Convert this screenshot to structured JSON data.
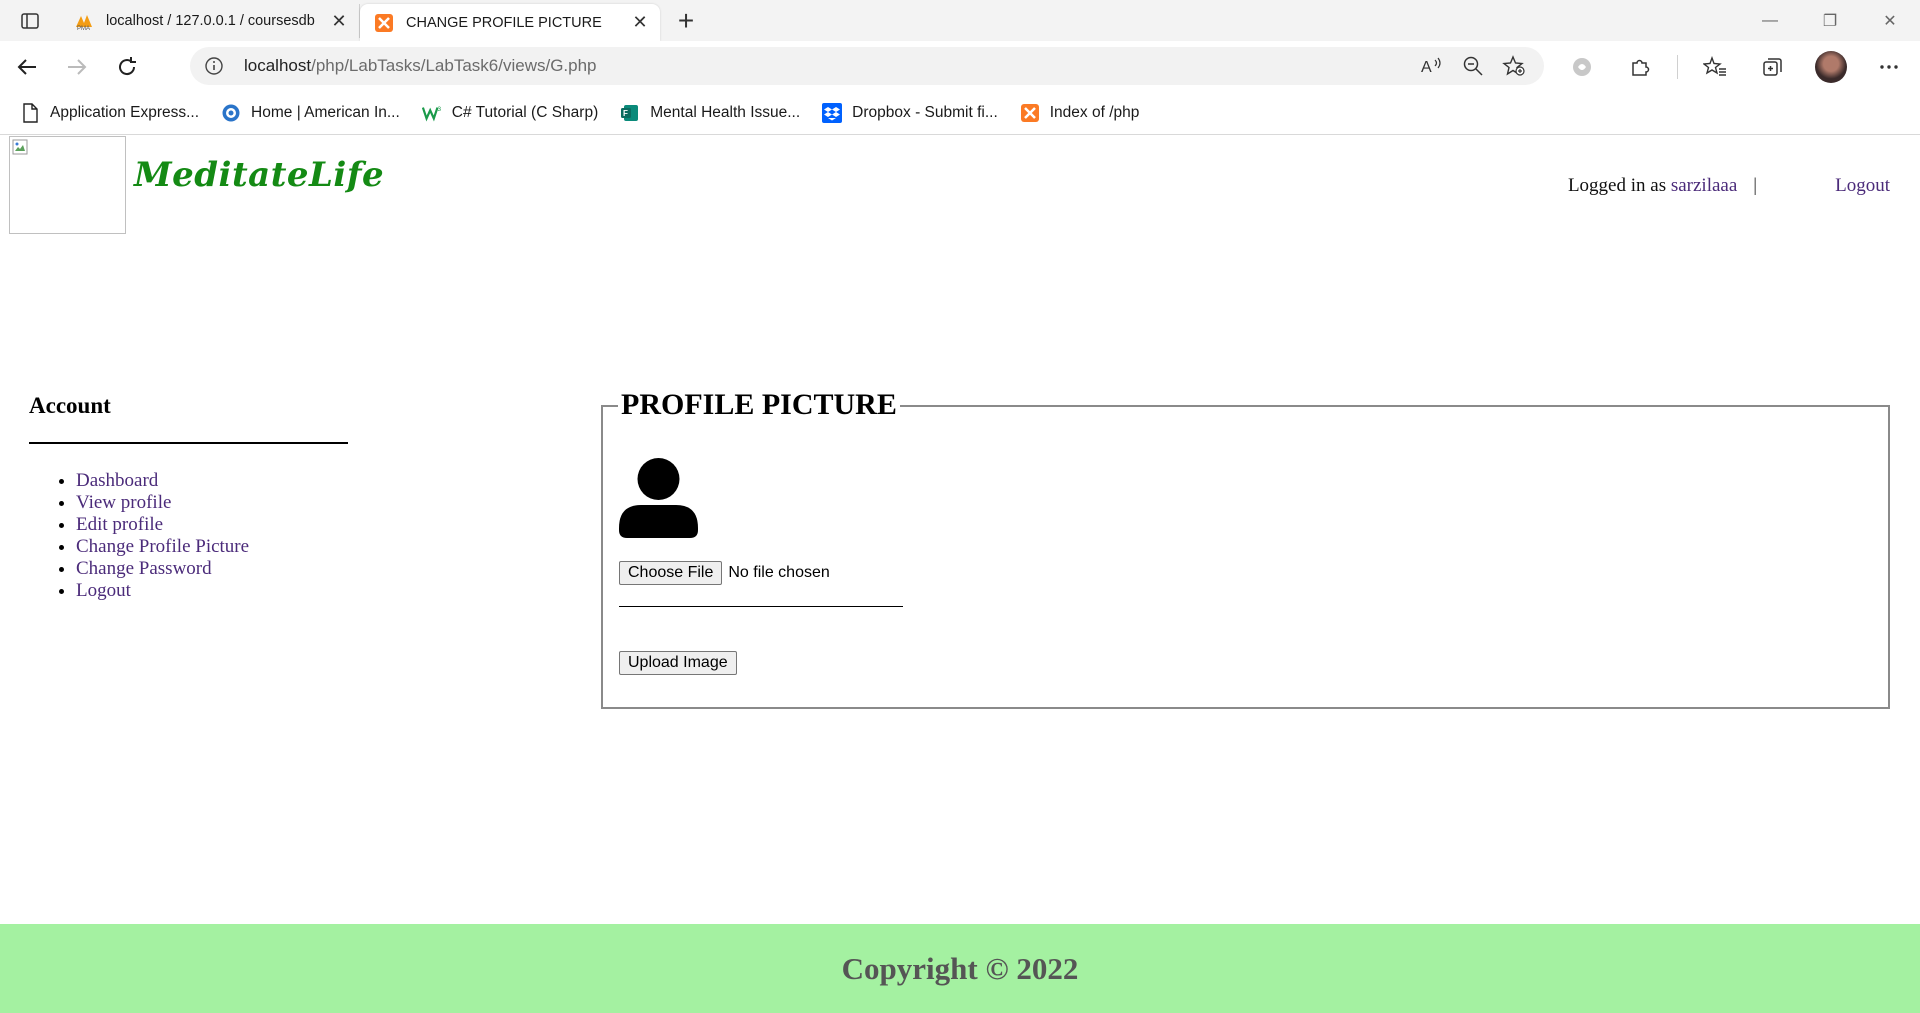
{
  "browser": {
    "tabs": [
      {
        "title": "localhost / 127.0.0.1 / coursesdb",
        "active": false
      },
      {
        "title": "CHANGE PROFILE PICTURE",
        "active": true
      }
    ],
    "url_host": "localhost",
    "url_path": "/php/LabTasks/LabTask6/views/G.php",
    "bookmarks": [
      {
        "label": "Application Express...",
        "icon": "page-icon"
      },
      {
        "label": "Home | American In...",
        "icon": "globe-icon"
      },
      {
        "label": "C# Tutorial (C Sharp)",
        "icon": "w3-icon"
      },
      {
        "label": "Mental Health Issue...",
        "icon": "forms-icon"
      },
      {
        "label": "Dropbox - Submit fi...",
        "icon": "dropbox-icon"
      },
      {
        "label": "Index of /php",
        "icon": "xampp-icon"
      }
    ]
  },
  "header": {
    "brand": "MeditateLife",
    "logged_in_prefix": "Logged in as",
    "username": "sarzilaaa",
    "separator": "|",
    "logout": "Logout"
  },
  "sidebar": {
    "title": "Account",
    "items": [
      {
        "label": "Dashboard"
      },
      {
        "label": "View profile"
      },
      {
        "label": "Edit profile"
      },
      {
        "label": "Change Profile Picture"
      },
      {
        "label": "Change Password"
      },
      {
        "label": "Logout"
      }
    ]
  },
  "main": {
    "legend": "PROFILE PICTURE",
    "choose_file": "Choose File",
    "no_file": "No file chosen",
    "upload": "Upload Image"
  },
  "footer": {
    "text": "Copyright © 2022"
  },
  "colors": {
    "brand": "#148a14",
    "link": "#4b2b7a",
    "footer_bg": "#a4f1a1"
  }
}
